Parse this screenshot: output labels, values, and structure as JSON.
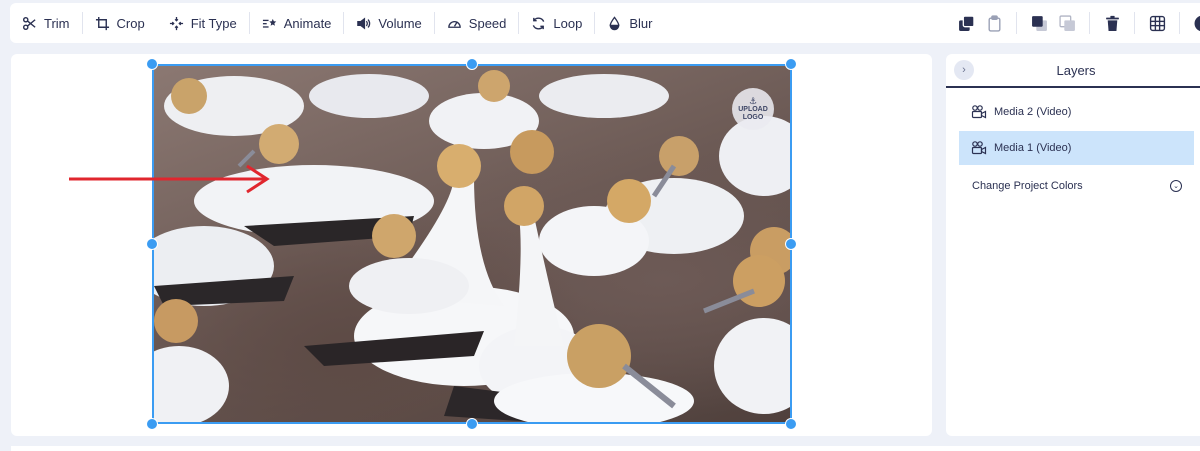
{
  "toolbar": {
    "tools": {
      "trim": "Trim",
      "crop": "Crop",
      "fit_type": "Fit Type",
      "animate": "Animate",
      "volume": "Volume",
      "speed": "Speed",
      "loop": "Loop",
      "blur": "Blur"
    },
    "right_icons": [
      "bring-forward-icon",
      "paste-icon",
      "layer-front-icon",
      "layer-back-icon",
      "trash-icon",
      "grid-icon",
      "play-icon"
    ]
  },
  "canvas": {
    "watermark": {
      "line1": "UPLOAD",
      "line2": "LOGO"
    },
    "selection_color": "#3b9cf2",
    "annotation_arrow_color": "#e0262e"
  },
  "layers": {
    "title": "Layers",
    "items": [
      {
        "label": "Media 2 (Video)",
        "selected": false
      },
      {
        "label": "Media 1 (Video)",
        "selected": true
      }
    ],
    "change_colors_label": "Change Project Colors"
  },
  "colors": {
    "accent": "#3b9cf2",
    "text": "#2b3152",
    "selected_bg": "#cce4fb",
    "background": "#eef1f8"
  }
}
